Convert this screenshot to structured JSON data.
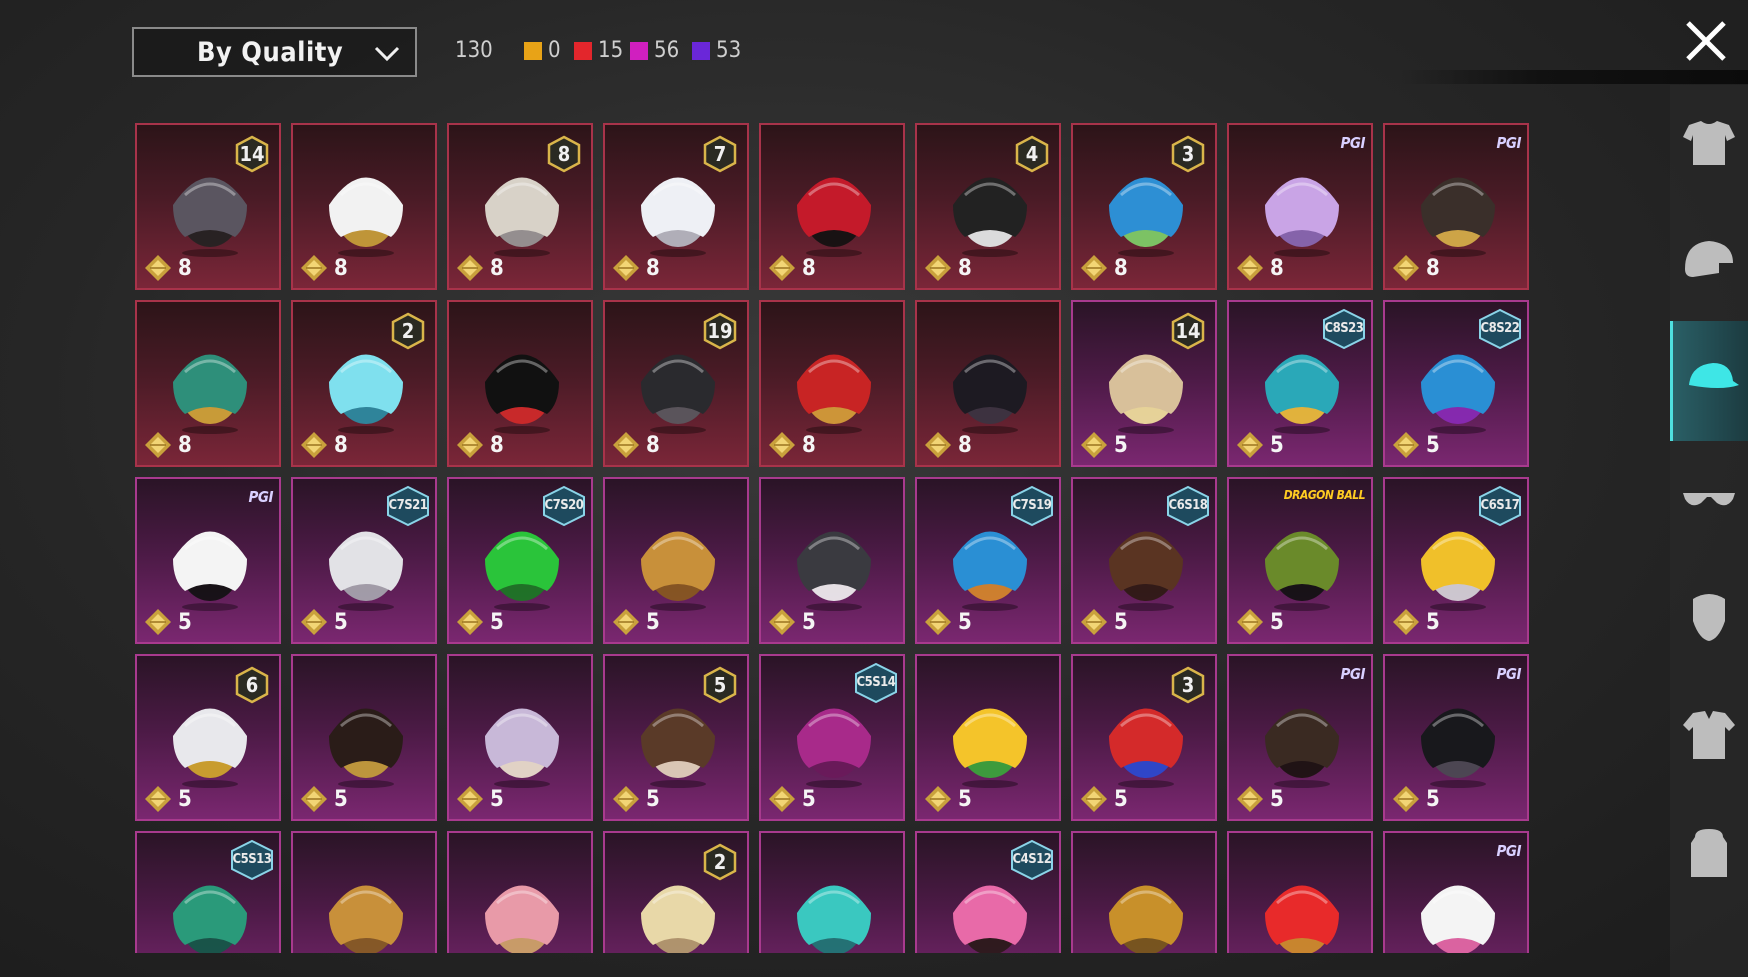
{
  "toolbar": {
    "sort_label": "By Quality",
    "total_count": "130",
    "quality_counts": [
      {
        "label": "0",
        "color": "#e8a317"
      },
      {
        "label": "15",
        "color": "#e3262c"
      },
      {
        "label": "56",
        "color": "#d01fbf"
      },
      {
        "label": "53",
        "color": "#6a27d9"
      }
    ]
  },
  "colors": {
    "red_card": "#7a2638",
    "pink_card": "#7a2770",
    "active_tab": "#4fe0e0"
  },
  "items": [
    {
      "q": "red",
      "pts": "8",
      "badge": {
        "type": "num",
        "text": "14"
      },
      "icon": "cat-ear-mask-helmet"
    },
    {
      "q": "red",
      "pts": "8",
      "badge": null,
      "icon": "white-cowboy-hat"
    },
    {
      "q": "red",
      "pts": "8",
      "badge": {
        "type": "num",
        "text": "8"
      },
      "icon": "silver-hair"
    },
    {
      "q": "red",
      "pts": "8",
      "badge": {
        "type": "num",
        "text": "7"
      },
      "icon": "white-long-hair"
    },
    {
      "q": "red",
      "pts": "8",
      "badge": null,
      "icon": "red-helmet"
    },
    {
      "q": "red",
      "pts": "8",
      "badge": {
        "type": "num",
        "text": "4"
      },
      "icon": "snowman-top-hat"
    },
    {
      "q": "red",
      "pts": "8",
      "badge": {
        "type": "num",
        "text": "3"
      },
      "icon": "joker-mask"
    },
    {
      "q": "red",
      "pts": "8",
      "badge": {
        "type": "text",
        "text": "PGI"
      },
      "icon": "lilac-hair"
    },
    {
      "q": "red",
      "pts": "8",
      "badge": {
        "type": "text",
        "text": "PGI"
      },
      "icon": "samurai-helmet"
    },
    {
      "q": "red",
      "pts": "8",
      "badge": null,
      "icon": "dragon-helmet"
    },
    {
      "q": "red",
      "pts": "8",
      "badge": {
        "type": "num",
        "text": "2"
      },
      "icon": "goggle-bucket-hat"
    },
    {
      "q": "red",
      "pts": "8",
      "badge": null,
      "icon": "demon-horn-helmet"
    },
    {
      "q": "red",
      "pts": "8",
      "badge": {
        "type": "num",
        "text": "19"
      },
      "icon": "black-combat-helmet"
    },
    {
      "q": "red",
      "pts": "8",
      "badge": null,
      "icon": "red-visor-helmet"
    },
    {
      "q": "red",
      "pts": "8",
      "badge": null,
      "icon": "dark-knight-helmet"
    },
    {
      "q": "pink",
      "pts": "5",
      "badge": {
        "type": "num",
        "text": "14"
      },
      "icon": "flower-hair"
    },
    {
      "q": "pink",
      "pts": "5",
      "badge": {
        "type": "season",
        "text": "C8S23"
      },
      "icon": "cat-headphones"
    },
    {
      "q": "pink",
      "pts": "5",
      "badge": {
        "type": "season",
        "text": "C8S22"
      },
      "icon": "blue-purple-hair"
    },
    {
      "q": "pink",
      "pts": "5",
      "badge": {
        "type": "text",
        "text": "PGI"
      },
      "icon": "panda-head"
    },
    {
      "q": "pink",
      "pts": "5",
      "badge": {
        "type": "season",
        "text": "C7S21"
      },
      "icon": "silver-spiky-hair"
    },
    {
      "q": "pink",
      "pts": "5",
      "badge": {
        "type": "season",
        "text": "C7S20"
      },
      "icon": "green-twin-tails"
    },
    {
      "q": "pink",
      "pts": "5",
      "badge": null,
      "icon": "blonde-long-hair"
    },
    {
      "q": "pink",
      "pts": "5",
      "badge": null,
      "icon": "shark-head"
    },
    {
      "q": "pink",
      "pts": "5",
      "badge": {
        "type": "season",
        "text": "C7S19"
      },
      "icon": "feather-headdress"
    },
    {
      "q": "pink",
      "pts": "5",
      "badge": {
        "type": "season",
        "text": "C6S18"
      },
      "icon": "brown-short-hair"
    },
    {
      "q": "pink",
      "pts": "5",
      "badge": {
        "type": "text",
        "text": "DRAGON BALL"
      },
      "icon": "green-cap-black-hair"
    },
    {
      "q": "pink",
      "pts": "5",
      "badge": {
        "type": "season",
        "text": "C6S17"
      },
      "icon": "yellow-visor-cap"
    },
    {
      "q": "pink",
      "pts": "5",
      "badge": {
        "type": "num",
        "text": "6"
      },
      "icon": "white-gold-helmet"
    },
    {
      "q": "pink",
      "pts": "5",
      "badge": null,
      "icon": "dark-bun-hair"
    },
    {
      "q": "pink",
      "pts": "5",
      "badge": null,
      "icon": "lavender-bonnet"
    },
    {
      "q": "pink",
      "pts": "5",
      "badge": {
        "type": "num",
        "text": "5"
      },
      "icon": "twin-bun-hair"
    },
    {
      "q": "pink",
      "pts": "5",
      "badge": {
        "type": "season",
        "text": "C5S14"
      },
      "icon": "magenta-hair"
    },
    {
      "q": "pink",
      "pts": "5",
      "badge": null,
      "icon": "orange-fruit-head"
    },
    {
      "q": "pink",
      "pts": "5",
      "badge": {
        "type": "num",
        "text": "3"
      },
      "icon": "jester-hat"
    },
    {
      "q": "pink",
      "pts": "5",
      "badge": {
        "type": "text",
        "text": "PGI"
      },
      "icon": "braided-hair"
    },
    {
      "q": "pink",
      "pts": "5",
      "badge": {
        "type": "text",
        "text": "PGI"
      },
      "icon": "black-panther-mask"
    },
    {
      "q": "pink",
      "pts": "",
      "badge": {
        "type": "season",
        "text": "C5S13"
      },
      "icon": "green-beast-hood"
    },
    {
      "q": "pink",
      "pts": "",
      "badge": null,
      "icon": "straw-sun-hat"
    },
    {
      "q": "pink",
      "pts": "",
      "badge": null,
      "icon": "pink-hair-boater"
    },
    {
      "q": "pink",
      "pts": "",
      "badge": {
        "type": "num",
        "text": "2"
      },
      "icon": "blonde-curly-beret"
    },
    {
      "q": "pink",
      "pts": "",
      "badge": null,
      "icon": "teal-feather-crest"
    },
    {
      "q": "pink",
      "pts": "",
      "badge": {
        "type": "season",
        "text": "C4S12"
      },
      "icon": "pink-visor"
    },
    {
      "q": "pink",
      "pts": "",
      "badge": null,
      "icon": "potato-head"
    },
    {
      "q": "pink",
      "pts": "",
      "badge": null,
      "icon": "red-bow-headband"
    },
    {
      "q": "pink",
      "pts": "",
      "badge": {
        "type": "text",
        "text": "PGI"
      },
      "icon": "bunny-mask"
    }
  ],
  "sidebar": [
    {
      "name": "outfit-tab",
      "icon": "outfit-icon",
      "active": false
    },
    {
      "name": "helmet-tab",
      "icon": "helmet-icon",
      "active": false
    },
    {
      "name": "hat-tab",
      "icon": "cap-icon",
      "active": true
    },
    {
      "name": "glasses-tab",
      "icon": "glasses-icon",
      "active": false
    },
    {
      "name": "mask-tab",
      "icon": "mask-icon",
      "active": false
    },
    {
      "name": "jacket-tab",
      "icon": "jacket-icon",
      "active": false
    },
    {
      "name": "backpack-tab",
      "icon": "backpack-icon",
      "active": false
    }
  ]
}
